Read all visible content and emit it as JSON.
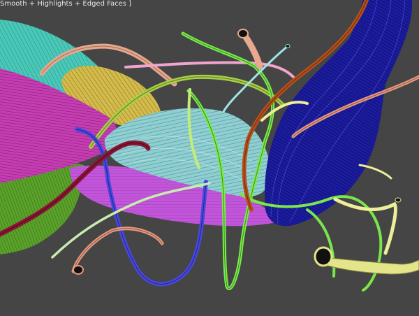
{
  "viewport": {
    "shading_label": "Smooth + Highlights + Edged Faces ]",
    "background_color": "#454545"
  },
  "scene": {
    "objects": [
      {
        "name": "teal-shell",
        "kind": "surface",
        "color": "#4fd1c2"
      },
      {
        "name": "magenta-shell",
        "kind": "surface",
        "color": "#c93fb6"
      },
      {
        "name": "green-shell",
        "kind": "surface",
        "color": "#5aa02c"
      },
      {
        "name": "yellow-shell",
        "kind": "surface",
        "color": "#d8be50"
      },
      {
        "name": "pale-blue-shell",
        "kind": "surface",
        "color": "#8fd5d8"
      },
      {
        "name": "violet-shell",
        "kind": "surface",
        "color": "#c058d8"
      },
      {
        "name": "navy-bundle",
        "kind": "surface",
        "color": "#1a1a9c"
      },
      {
        "name": "peach-tube",
        "kind": "tube",
        "color": "#e6a58a"
      },
      {
        "name": "olive-tube",
        "kind": "tube",
        "color": "#a8d04a"
      },
      {
        "name": "lime-tube",
        "kind": "tube",
        "color": "#7dee4c"
      },
      {
        "name": "pink-tube",
        "kind": "tube",
        "color": "#f0a6d0"
      },
      {
        "name": "rust-tube",
        "kind": "tube",
        "color": "#b8501c"
      },
      {
        "name": "blue-tube",
        "kind": "tube",
        "color": "#4a4ae0"
      },
      {
        "name": "maroon-tube",
        "kind": "tube",
        "color": "#8e1638"
      },
      {
        "name": "light-yellow-tube",
        "kind": "tube",
        "color": "#f0f09a"
      },
      {
        "name": "pale-green-tube",
        "kind": "tube",
        "color": "#c8f0b0"
      },
      {
        "name": "salmon-tube",
        "kind": "tube",
        "color": "#e89a80"
      },
      {
        "name": "light-lime-tube",
        "kind": "tube",
        "color": "#c6ee7a"
      },
      {
        "name": "cyan-tube",
        "kind": "tube",
        "color": "#9ee8e8"
      }
    ]
  }
}
